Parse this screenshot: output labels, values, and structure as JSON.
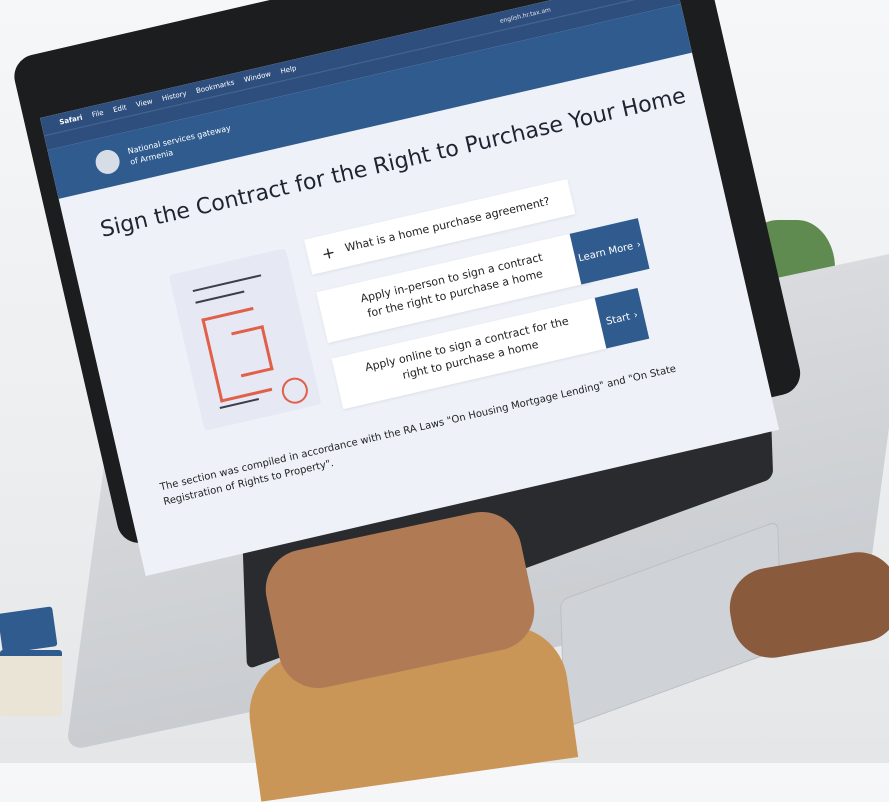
{
  "macos": {
    "apple": "",
    "app": "Safari",
    "menus": [
      "File",
      "Edit",
      "View",
      "History",
      "Bookmarks",
      "Window",
      "Help"
    ],
    "url": "english.hr.tax.am"
  },
  "site": {
    "name_line1": "National services gateway",
    "name_line2": "of Armenia"
  },
  "page": {
    "title": "Sign the Contract for the Right to Purchase Your Home",
    "options": [
      {
        "icon": "+",
        "label": "What is a home purchase agreement?",
        "button": ""
      },
      {
        "icon": "",
        "label": "Apply in-person to sign a contract for the right to purchase a home",
        "button": "Learn More"
      },
      {
        "icon": "",
        "label": "Apply online to sign a contract for the right to purchase a home",
        "button": "Start"
      }
    ],
    "footnote": "The section was compiled in accordance with the RA Laws \"On Housing Mortgage Lending\" and \"On State Registration of Rights to Property\"."
  },
  "colors": {
    "brand_blue": "#2f5b8e",
    "accent_red": "#e0604a",
    "page_bg": "#eef2f8"
  }
}
